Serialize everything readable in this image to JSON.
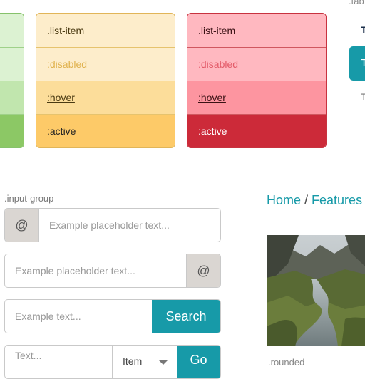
{
  "list_groups": {
    "yellow": [
      ".list-item",
      ":disabled",
      ":hover",
      ":active"
    ],
    "red": [
      ".list-item",
      ":disabled",
      ":hover",
      ":active"
    ]
  },
  "tabs": {
    "caption": ".tab",
    "items": [
      "T",
      "T",
      "T"
    ]
  },
  "input_group": {
    "caption": ".input-group",
    "row1": {
      "addon": "@",
      "placeholder": "Example placeholder text..."
    },
    "row2": {
      "placeholder": "Example placeholder text...",
      "addon": "@"
    },
    "row3": {
      "placeholder": "Example text...",
      "button": "Search"
    },
    "row4": {
      "placeholder": "Text...",
      "select": "Item",
      "button": "Go"
    }
  },
  "breadcrumb": {
    "items": [
      "Home",
      "Features"
    ],
    "separator": "/"
  },
  "image": {
    "caption": ".rounded"
  },
  "colors": {
    "accent": "#179aa8",
    "warning_active": "#fdca68",
    "danger_active": "#cc2a39",
    "success_active": "#8cc865"
  }
}
